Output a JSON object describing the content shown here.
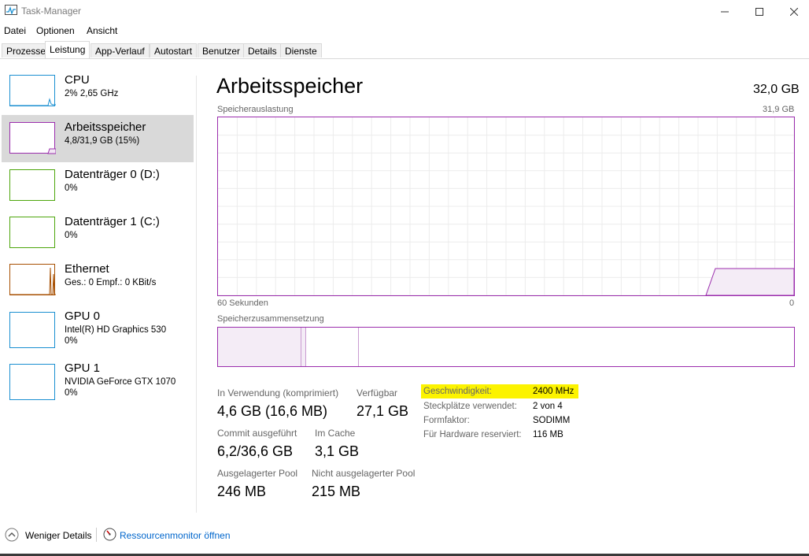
{
  "window": {
    "title": "Task-Manager"
  },
  "menu": [
    "Datei",
    "Optionen",
    "Ansicht"
  ],
  "tabs": [
    "Prozesse",
    "Leistung",
    "App-Verlauf",
    "Autostart",
    "Benutzer",
    "Details",
    "Dienste"
  ],
  "active_tab": "Leistung",
  "sidebar": {
    "items": [
      {
        "name": "CPU",
        "sub": "2%  2,65 GHz",
        "sub2": "",
        "color": "#1a8fd1"
      },
      {
        "name": "Arbeitsspeicher",
        "sub": "4,8/31,9 GB (15%)",
        "sub2": "",
        "color": "#9b2dad"
      },
      {
        "name": "Datenträger 0 (D:)",
        "sub": "0%",
        "sub2": "",
        "color": "#4da60c"
      },
      {
        "name": "Datenträger 1 (C:)",
        "sub": "0%",
        "sub2": "",
        "color": "#4da60c"
      },
      {
        "name": "Ethernet",
        "sub": "Ges.: 0  Empf.: 0 KBit/s",
        "sub2": "",
        "color": "#a74f01"
      },
      {
        "name": "GPU 0",
        "sub": "Intel(R) HD Graphics 530",
        "sub2": "0%",
        "color": "#1a8fd1"
      },
      {
        "name": "GPU 1",
        "sub": "NVIDIA GeForce GTX 1070",
        "sub2": "0%",
        "color": "#1a8fd1"
      }
    ]
  },
  "main": {
    "title": "Arbeitsspeicher",
    "total": "32,0 GB",
    "usage_label": "Speicherauslastung",
    "usage_max": "31,9 GB",
    "time_left": "60 Sekunden",
    "time_right": "0",
    "composition_label": "Speicherzusammensetzung",
    "stats": {
      "in_use_label": "In Verwendung (komprimiert)",
      "in_use_value": "4,6 GB (16,6 MB)",
      "available_label": "Verfügbar",
      "available_value": "27,1 GB",
      "commit_label": "Commit ausgeführt",
      "commit_value": "6,2/36,6 GB",
      "cache_label": "Im Cache",
      "cache_value": "3,1 GB",
      "paged_label": "Ausgelagerter Pool",
      "paged_value": "246 MB",
      "nonpaged_label": "Nicht ausgelagerter Pool",
      "nonpaged_value": "215 MB"
    },
    "info": {
      "speed_label": "Geschwindigkeit:",
      "speed_value": "2400 MHz",
      "slots_label": "Steckplätze verwendet:",
      "slots_value": "2 von 4",
      "form_label": "Formfaktor:",
      "form_value": "SODIMM",
      "reserved_label": "Für Hardware reserviert:",
      "reserved_value": "116 MB"
    }
  },
  "footer": {
    "less_details": "Weniger Details",
    "resource_monitor": "Ressourcenmonitor öffnen"
  },
  "colors": {
    "memory": "#9b2dad",
    "highlight": "#fcf300",
    "link": "#0066cc"
  }
}
